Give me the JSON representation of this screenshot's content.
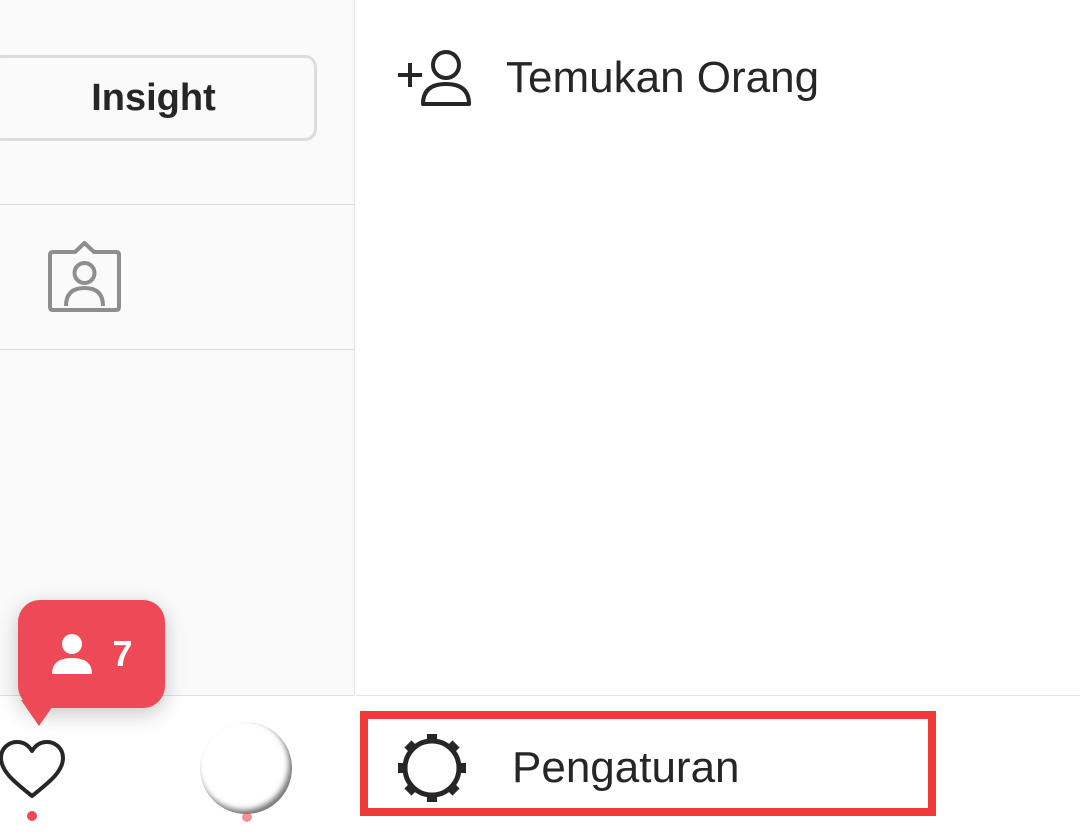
{
  "left_panel": {
    "insight_button_label": "Insight",
    "tagged_icon": "tagged-photos-icon"
  },
  "notification": {
    "icon": "person-icon",
    "count": "7",
    "color": "#ed4956"
  },
  "bottom_nav": {
    "heart_icon": "heart-icon",
    "avatar": "profile-avatar"
  },
  "menu": {
    "find_people_label": "Temukan Orang",
    "find_people_icon": "add-person-icon",
    "settings_label": "Pengaturan",
    "settings_icon": "gear-icon",
    "highlight_color": "#f03a3a"
  }
}
